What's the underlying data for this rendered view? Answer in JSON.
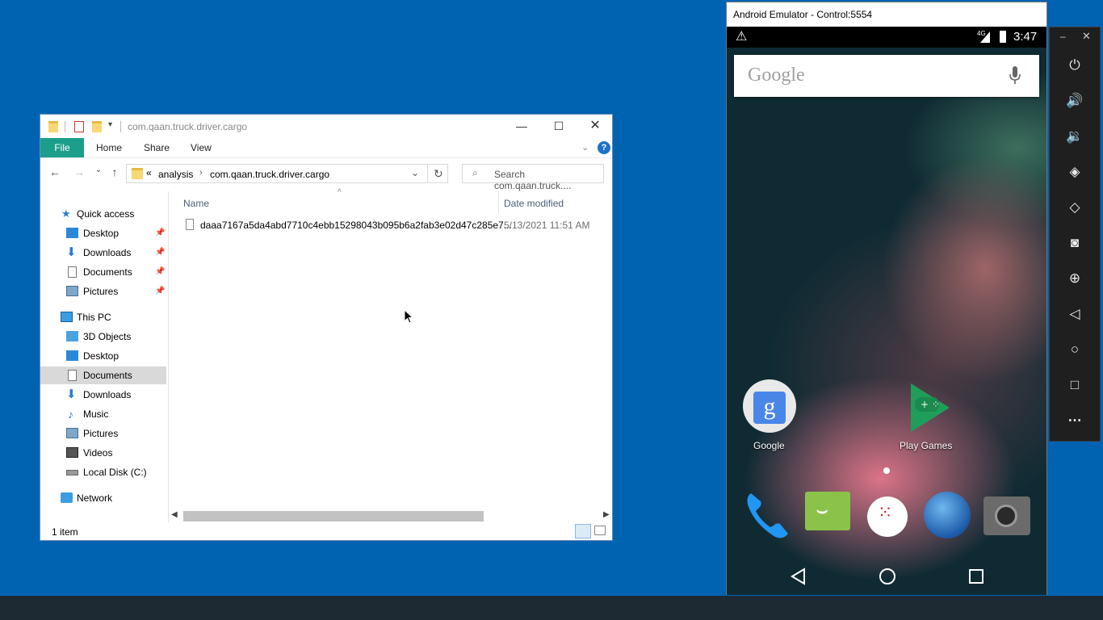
{
  "explorer": {
    "title": "com.qaan.truck.driver.cargo",
    "ribbon_tabs": [
      "File",
      "Home",
      "Share",
      "View"
    ],
    "breadcrumb": {
      "overflow": "«",
      "segments": [
        "analysis",
        "com.qaan.truck.driver.cargo"
      ]
    },
    "search_placeholder": "Search com.qaan.truck....",
    "nav": {
      "quick_access": "Quick access",
      "quick_items": [
        "Desktop",
        "Downloads",
        "Documents",
        "Pictures"
      ],
      "this_pc": "This PC",
      "pc_items": [
        "3D Objects",
        "Desktop",
        "Documents",
        "Downloads",
        "Music",
        "Pictures",
        "Videos",
        "Local Disk (C:)"
      ],
      "network": "Network",
      "selected": "Documents"
    },
    "columns": {
      "name": "Name",
      "date": "Date modified"
    },
    "files": [
      {
        "name": "daaa7167a5da4abd7710c4ebb15298043b095b6a2fab3e02d47c285e7...",
        "date": "5/13/2021 11:51 AM"
      }
    ],
    "status": "1 item"
  },
  "emulator": {
    "title": "Android Emulator - Control:5554",
    "network": "4G",
    "time": "3:47",
    "search_hint": "Google",
    "apps": [
      {
        "label": "Google",
        "icon": "google-app-icon"
      },
      {
        "label": "Play Games",
        "icon": "play-games-icon"
      }
    ],
    "dock": [
      "phone-icon",
      "messaging-icon",
      "app-drawer-icon",
      "browser-icon",
      "camera-icon"
    ],
    "toolbar": [
      "power-icon",
      "volume-up-icon",
      "volume-down-icon",
      "rotate-left-icon",
      "rotate-right-icon",
      "screenshot-icon",
      "zoom-icon",
      "back-icon",
      "home-icon",
      "overview-icon",
      "more-icon"
    ]
  },
  "colors": {
    "desktop": "#0063b1",
    "file_tab": "#1b9f8a",
    "selection": "#d9d9d9",
    "taskbar": "#1e2a33"
  }
}
